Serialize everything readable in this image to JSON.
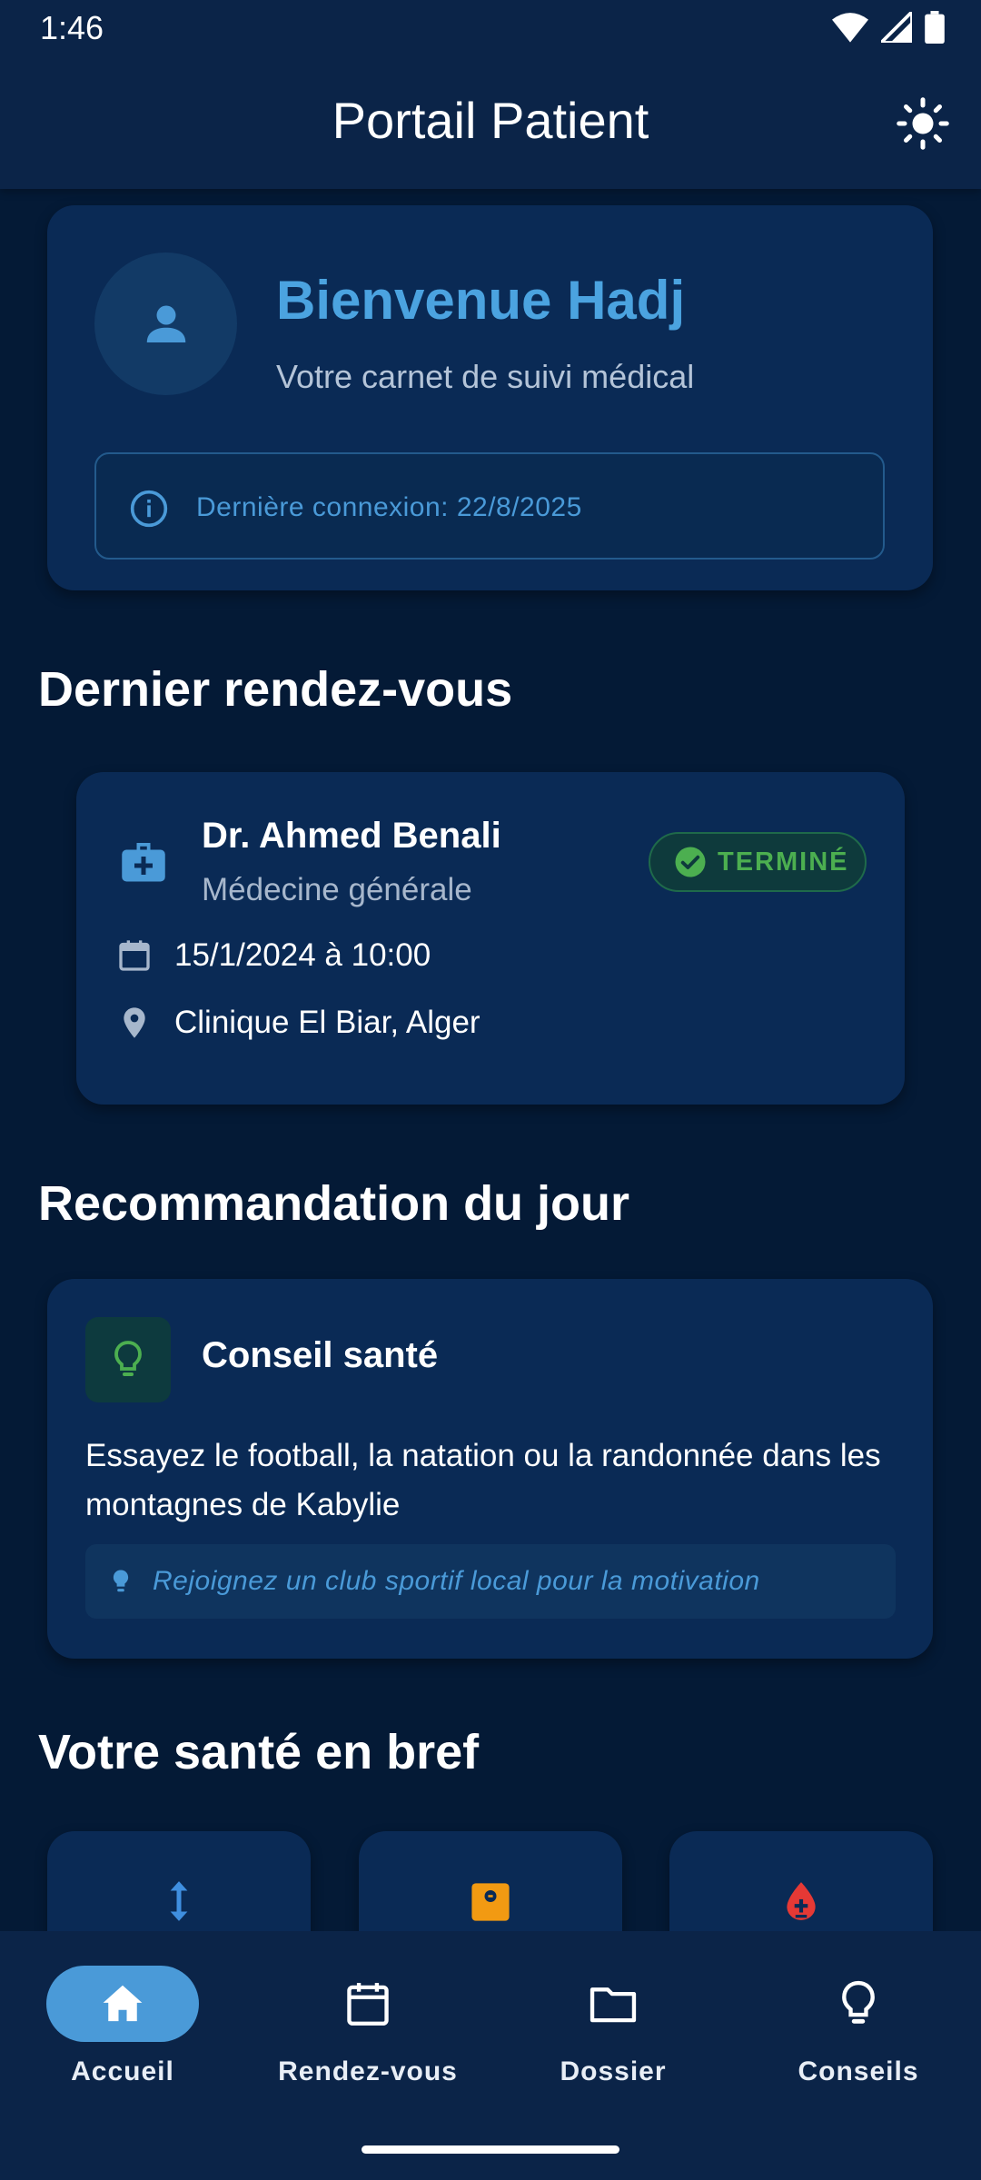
{
  "status_bar": {
    "time": "1:46"
  },
  "app_bar": {
    "title": "Portail Patient"
  },
  "welcome": {
    "title": "Bienvenue Hadj",
    "subtitle": "Votre carnet de suivi médical",
    "last_login": "Dernière connexion: 22/8/2025"
  },
  "sections": {
    "last_appointment": "Dernier rendez-vous",
    "recommendation": "Recommandation du jour",
    "health_summary": "Votre santé en bref"
  },
  "appointment": {
    "doctor": "Dr. Ahmed Benali",
    "specialty": "Médecine générale",
    "status": "TERMINÉ",
    "datetime": "15/1/2024 à 10:00",
    "location": "Clinique El Biar, Alger"
  },
  "recommendation": {
    "title": "Conseil santé",
    "text": "Essayez le football, la natation ou la randonnée dans les montagnes de Kabylie",
    "tip": "Rejoignez un club sportif local pour la motivation"
  },
  "health_cards": [
    {
      "icon": "height-icon",
      "color": "#3f8fe0"
    },
    {
      "icon": "scale-icon",
      "color": "#f29a12"
    },
    {
      "icon": "blood-drop-icon",
      "color": "#e53935"
    }
  ],
  "bottom_nav": {
    "items": [
      {
        "label": "Accueil",
        "active": true
      },
      {
        "label": "Rendez-vous",
        "active": false
      },
      {
        "label": "Dossier",
        "active": false
      },
      {
        "label": "Conseils",
        "active": false
      }
    ]
  },
  "colors": {
    "background": "#041a36",
    "card": "#0a2a55",
    "accent": "#4a9ad8",
    "success": "#4caf50"
  }
}
